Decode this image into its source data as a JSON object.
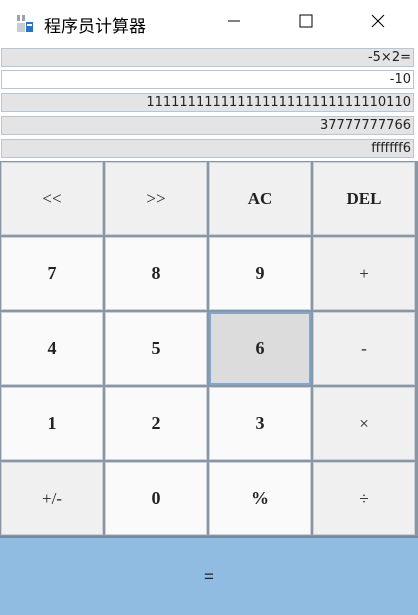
{
  "window": {
    "title": "程序员计算器",
    "icon": "calculator-icon",
    "controls": [
      "minimize-icon",
      "maximize-icon",
      "close-icon"
    ]
  },
  "display": {
    "expression": "-5×2=",
    "decimal": "-10",
    "binary": "11111111111111111111111111110110",
    "octal": "37777777766",
    "hex": "fffffff6"
  },
  "keys": {
    "shift_left": "<<",
    "shift_right": ">>",
    "ac": "AC",
    "del": "DEL",
    "k7": "7",
    "k8": "8",
    "k9": "9",
    "plus": "+",
    "k4": "4",
    "k5": "5",
    "k6": "6",
    "minus": "-",
    "k1": "1",
    "k2": "2",
    "k3": "3",
    "times": "×",
    "negate": "+/-",
    "k0": "0",
    "percent": "%",
    "divide": "÷",
    "equals": "="
  },
  "colors": {
    "equals_bg": "#90bce2",
    "active_key_border": "#7ea6cf",
    "display_border": "#b6c6d8"
  }
}
